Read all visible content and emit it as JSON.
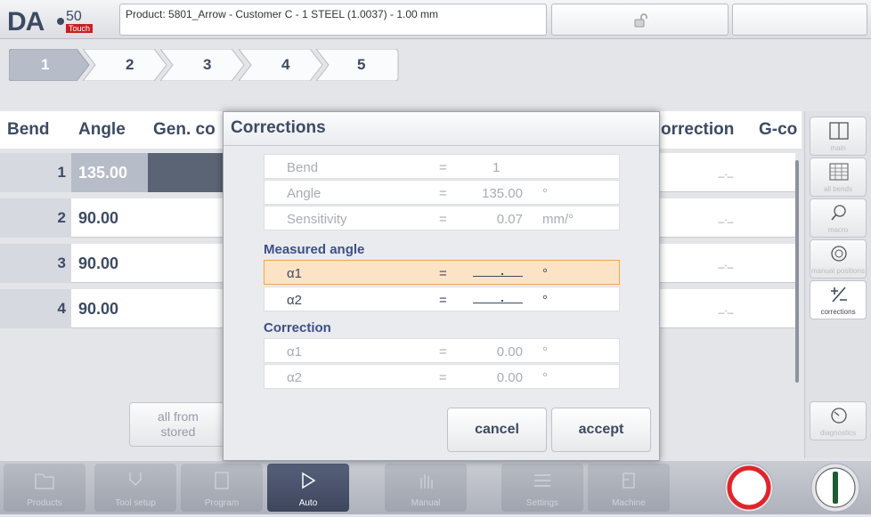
{
  "header": {
    "logo_text": "DA",
    "logo_model": "50",
    "logo_touch": "Touch",
    "product": "Product: 5801_Arrow - Customer C - 1 STEEL (1.0037) - 1.00 mm",
    "lock_icon": "unlock-icon"
  },
  "steps": [
    "1",
    "2",
    "3",
    "4",
    "5"
  ],
  "table": {
    "headers": {
      "bend": "Bend",
      "angle": "Angle",
      "gen": "Gen. co",
      "correction": "orrection",
      "gcode": "G-co"
    },
    "rows": [
      {
        "bend": "1",
        "angle": "135.00",
        "corr": "_._"
      },
      {
        "bend": "2",
        "angle": "90.00",
        "corr": "_._"
      },
      {
        "bend": "3",
        "angle": "90.00",
        "corr": "_._"
      },
      {
        "bend": "4",
        "angle": "90.00",
        "corr": "_._"
      }
    ]
  },
  "all_from_stored": {
    "line1": "all from",
    "line2": "stored"
  },
  "sidebar": [
    {
      "label": "main",
      "icon": "columns-icon"
    },
    {
      "label": "all bends",
      "icon": "grid-icon"
    },
    {
      "label": "macro",
      "icon": "magnifier-icon"
    },
    {
      "label": "manual positions",
      "icon": "dial-icon"
    },
    {
      "label": "corrections",
      "icon": "plus-minus-icon"
    },
    {
      "label": "diagnostics",
      "icon": "gauge-icon"
    }
  ],
  "bottom_nav": [
    {
      "label": "Products",
      "icon": "folder-icon"
    },
    {
      "label": "Tool setup",
      "icon": "tool-icon"
    },
    {
      "label": "Program",
      "icon": "program-icon"
    },
    {
      "label": "Auto",
      "icon": "play-icon"
    },
    {
      "label": "Manual",
      "icon": "hand-icon"
    },
    {
      "label": "Settings",
      "icon": "settings-icon"
    },
    {
      "label": "Machine",
      "icon": "machine-icon"
    }
  ],
  "dialog": {
    "title": "Corrections",
    "info": [
      {
        "key": "Bend",
        "eq": "=",
        "value": "1",
        "unit": ""
      },
      {
        "key": "Angle",
        "eq": "=",
        "value": "135.00",
        "unit": "°"
      },
      {
        "key": "Sensitivity",
        "eq": "=",
        "value": "0.07",
        "unit": "mm/°"
      }
    ],
    "measured_title": "Measured angle",
    "measured": [
      {
        "key": "α1",
        "eq": "=",
        "unit": "°"
      },
      {
        "key": "α2",
        "eq": "=",
        "unit": "°"
      }
    ],
    "correction_title": "Correction",
    "correction": [
      {
        "key": "α1",
        "eq": "=",
        "value": "0.00",
        "unit": "°"
      },
      {
        "key": "α2",
        "eq": "=",
        "value": "0.00",
        "unit": "°"
      }
    ],
    "cancel": "cancel",
    "accept": "accept"
  },
  "colors": {
    "accent": "#3d4a63",
    "highlight": "#fde3c5",
    "stop": "#e0242b",
    "start": "#1f5a32"
  }
}
